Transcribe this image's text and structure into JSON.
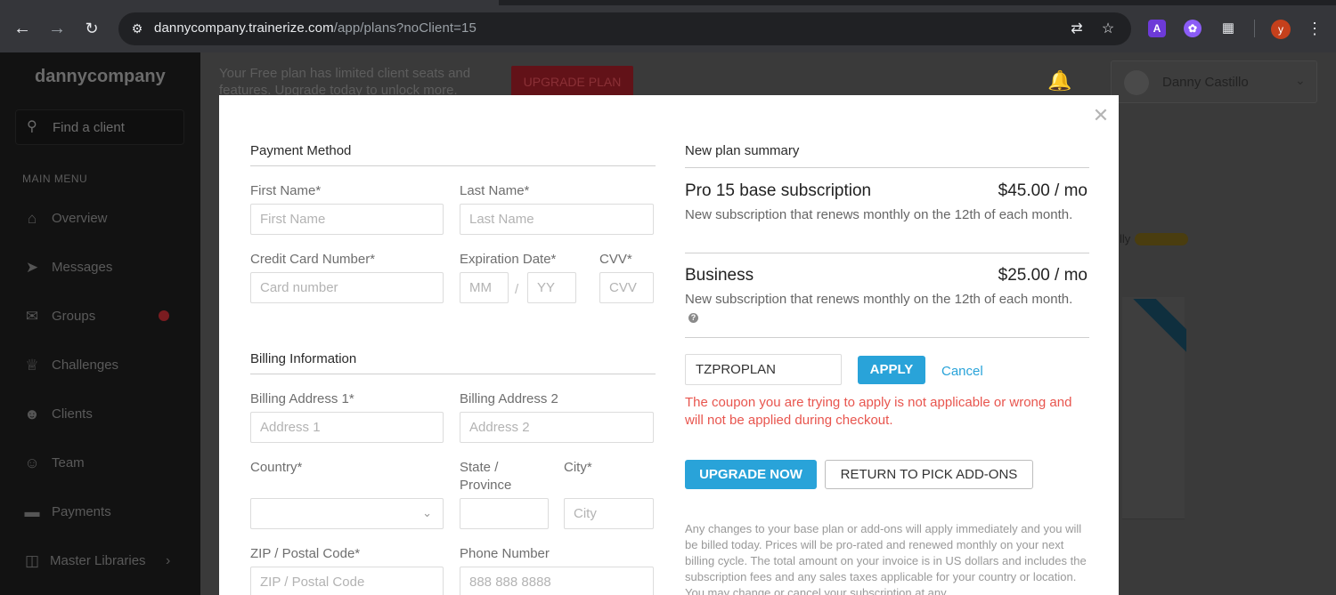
{
  "browser": {
    "url_host": "dannycompany.trainerize.com",
    "url_path": "/app/plans?noClient=15",
    "profile_initial": "y"
  },
  "sidebar": {
    "brand": "dannycompany",
    "search_placeholder": "Find a client",
    "section_label": "MAIN MENU",
    "items": [
      {
        "label": "Overview",
        "icon": "home-icon"
      },
      {
        "label": "Messages",
        "icon": "send-icon"
      },
      {
        "label": "Groups",
        "icon": "chat-icon"
      },
      {
        "label": "Challenges",
        "icon": "trophy-icon"
      },
      {
        "label": "Clients",
        "icon": "users-icon"
      },
      {
        "label": "Team",
        "icon": "person-icon"
      },
      {
        "label": "Payments",
        "icon": "card-icon"
      },
      {
        "label": "Master Libraries",
        "icon": "library-icon"
      }
    ]
  },
  "header": {
    "banner": "Your Free plan has limited client seats and features. Upgrade today to unlock more.",
    "upgrade_label": "UPGRADE PLAN",
    "user_name": "Danny Castillo"
  },
  "background": {
    "ly": "lly"
  },
  "payment": {
    "title": "Payment Method",
    "first_name": {
      "label": "First Name*",
      "placeholder": "First Name"
    },
    "last_name": {
      "label": "Last Name*",
      "placeholder": "Last Name"
    },
    "card_number": {
      "label": "Credit Card Number*",
      "placeholder": "Card number"
    },
    "expiration": {
      "label": "Expiration Date*",
      "mm": "MM",
      "separator": "/",
      "yy": "YY"
    },
    "cvv": {
      "label": "CVV*",
      "placeholder": "CVV"
    }
  },
  "billing": {
    "title": "Billing Information",
    "address1": {
      "label": "Billing Address 1*",
      "placeholder": "Address 1"
    },
    "address2": {
      "label": "Billing Address 2",
      "placeholder": "Address 2"
    },
    "country": {
      "label": "Country*",
      "value": ""
    },
    "state": {
      "label": "State / Province",
      "value": ""
    },
    "city": {
      "label": "City*",
      "placeholder": "City"
    },
    "zip": {
      "label": "ZIP / Postal Code*",
      "placeholder": "ZIP / Postal Code"
    },
    "phone": {
      "label": "Phone Number",
      "placeholder": "888 888 8888"
    }
  },
  "summary": {
    "title": "New plan summary",
    "items": [
      {
        "name": "Pro 15 base subscription",
        "price": "$45.00 / mo",
        "desc": "New subscription that renews monthly on the 12th of each month."
      },
      {
        "name": "Business",
        "price": "$25.00 / mo",
        "desc": "New subscription that renews monthly on the 12th of each month."
      }
    ],
    "info_glyph": "?",
    "coupon_value": "TZPROPLAN",
    "apply_label": "APPLY",
    "cancel_label": "Cancel",
    "error": "The coupon you are trying to apply is not applicable or wrong and will not be applied during checkout.",
    "upgrade_now_label": "UPGRADE NOW",
    "return_label": "RETURN TO PICK ADD-ONS",
    "fine_print": "Any changes to your base plan or add-ons will apply immediately and you will be billed today. Prices will be pro-rated and renewed monthly on your next billing cycle. The total amount on your invoice is in US dollars and includes the subscription fees and any sales taxes applicable for your country or location. You may change or cancel your subscription at any"
  },
  "colors": {
    "accent": "#29a3d9",
    "error": "#e8554e",
    "overlay_bg": "#3a3a3a"
  }
}
